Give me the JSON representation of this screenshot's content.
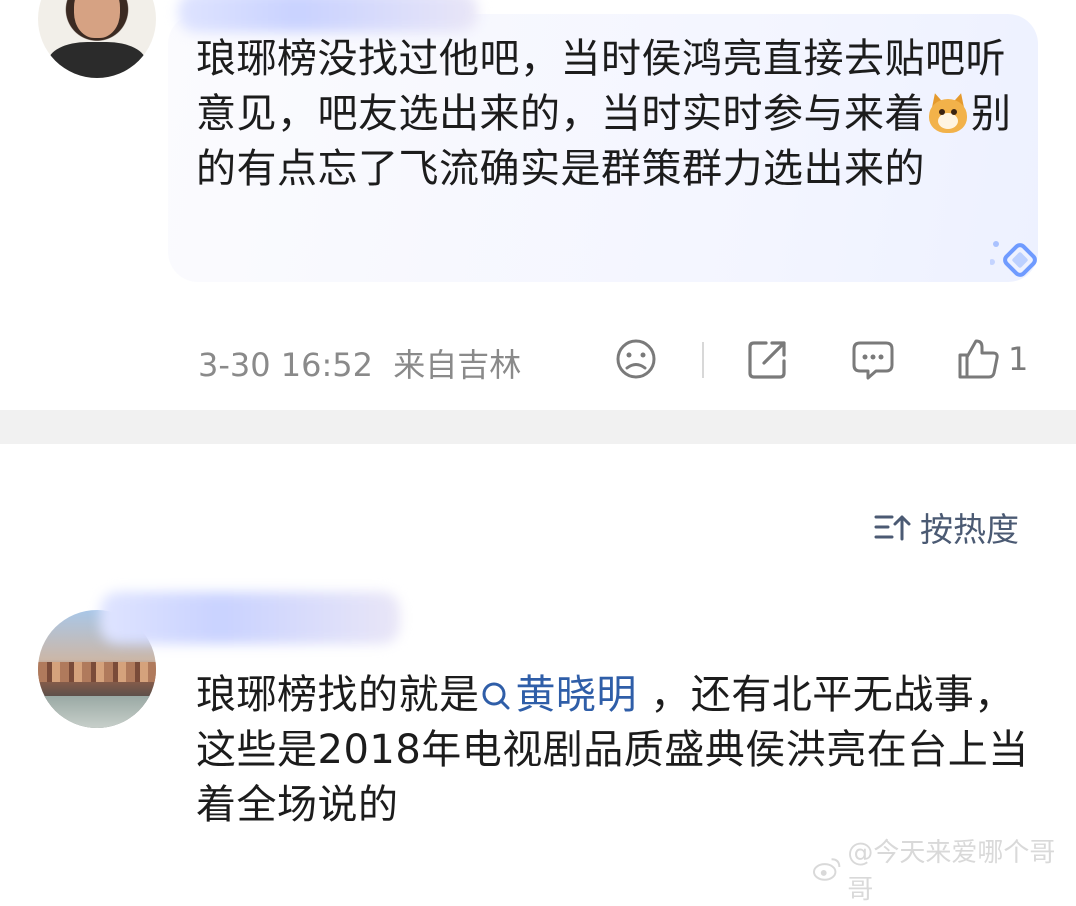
{
  "comment1": {
    "text_parts": [
      "琅琊榜没找过他吧，当时侯鸿亮直接去贴吧听意见，吧友选出来的，当时实时参与来着",
      "别的有点忘了飞流确实是群策群力选出来的"
    ],
    "emoji": "dog-emoji",
    "timestamp": "3-30 16:52",
    "location": "来自吉林",
    "like_count": "1"
  },
  "sort_label": "按热度",
  "comment2": {
    "text_before": "琅琊榜找的就是",
    "mention": "黄晓明",
    "text_after": " ，还有北平无战事，这些是2018年电视剧品质盛典侯洪亮在台上当着全场说的"
  },
  "watermark": "@今天来爱哪个哥哥",
  "colors": {
    "mention": "#2f5ea8",
    "meta_text": "#8a8a8a",
    "bubble": "#f3f5ff",
    "separator": "#f1f1f1"
  },
  "icons": [
    "dislike-icon",
    "share-icon",
    "comment-icon",
    "like-icon",
    "sort-icon",
    "search-icon",
    "weibo-logo"
  ]
}
